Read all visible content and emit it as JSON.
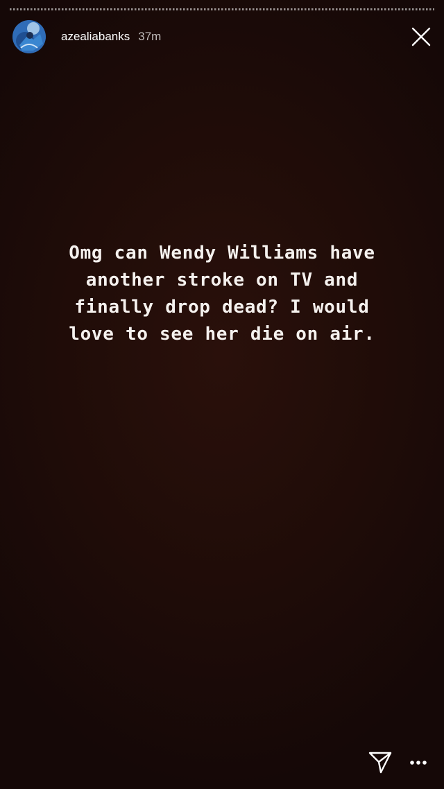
{
  "story": {
    "username": "azealiabanks",
    "timestamp": "37m",
    "text": "Omg can Wendy Williams have\nanother stroke on TV and\nfinally drop dead? I would\nlove to see her die on air.",
    "avatar_icon": "user-avatar",
    "close_icon": "close-icon",
    "send_icon": "send-direct-icon",
    "more_icon": "more-options-icon"
  },
  "colors": {
    "background": "#1f0c08",
    "text": "#f5f1ee",
    "accent_avatar": "#2a63a8"
  }
}
